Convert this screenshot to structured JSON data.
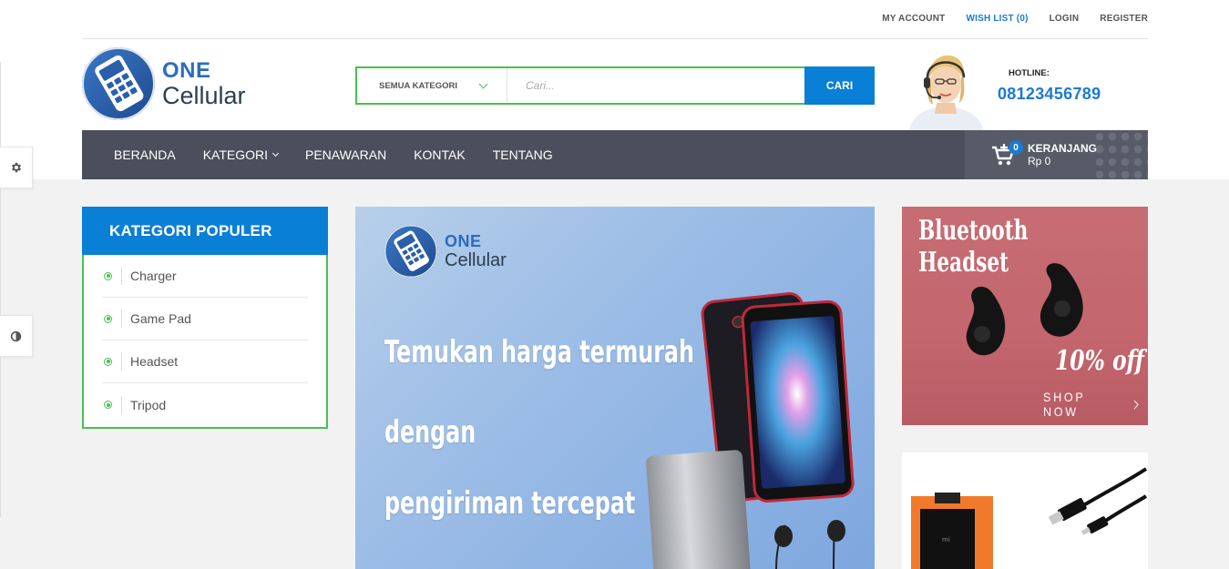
{
  "toplinks": {
    "my_account": "MY ACCOUNT",
    "wish_list": "WISH LIST (0)",
    "login": "LOGIN",
    "register": "REGISTER"
  },
  "logo": {
    "line1": "ONE",
    "line2": "Cellular"
  },
  "search": {
    "category": "SEMUA KATEGORI",
    "placeholder": "Cari...",
    "button": "CARI"
  },
  "hotline": {
    "label": "HOTLINE:",
    "number": "08123456789"
  },
  "nav": {
    "items": [
      "BERANDA",
      "KATEGORI",
      "PENAWARAN",
      "KONTAK",
      "TENTANG"
    ]
  },
  "cart": {
    "count": "0",
    "title": "KERANJANG",
    "total": "Rp 0"
  },
  "categories": {
    "title": "KATEGORI POPULER",
    "items": [
      "Charger",
      "Game Pad",
      "Headset",
      "Tripod"
    ]
  },
  "hero": {
    "logo_line1": "ONE",
    "logo_line2": "Cellular",
    "lines": [
      "Temukan harga termurah",
      "dengan",
      "pengiriman tercepat"
    ]
  },
  "promo1": {
    "title_line1": "Bluetooth",
    "title_line2": "Headset",
    "discount": "10% off",
    "cta": "SHOP NOW"
  },
  "colors": {
    "accent_blue": "#0a7fd6",
    "accent_green": "#47c14f",
    "nav_bg": "#4b4f5c",
    "promo_red": "#c3666d"
  },
  "icons": {
    "settings": "gear-icon",
    "contrast": "contrast-icon",
    "cart": "cart-icon"
  }
}
